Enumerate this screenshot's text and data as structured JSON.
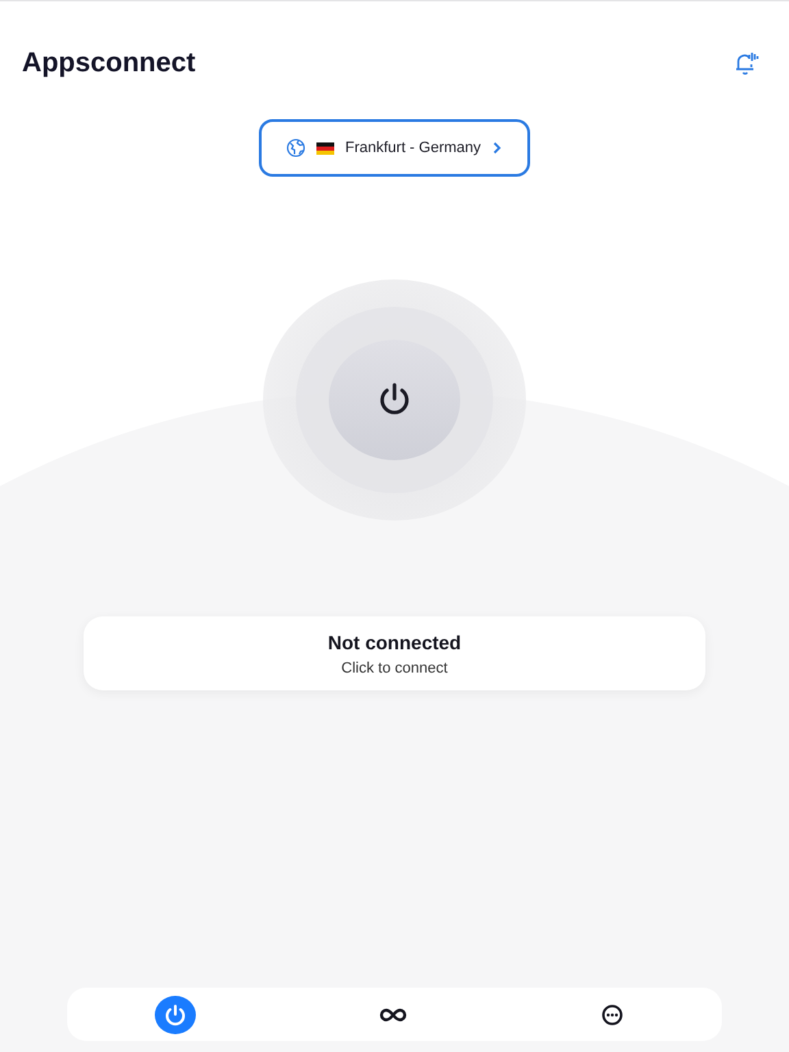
{
  "header": {
    "title": "Appsconnect"
  },
  "location": {
    "label": "Frankfurt - Germany"
  },
  "connection": {
    "connected": false
  },
  "status": {
    "title": "Not connected",
    "subtitle": "Click to connect"
  },
  "tabs": [
    {
      "kind": "power",
      "selected": true
    },
    {
      "kind": "infinity",
      "selected": false
    },
    {
      "kind": "more",
      "selected": false
    }
  ]
}
